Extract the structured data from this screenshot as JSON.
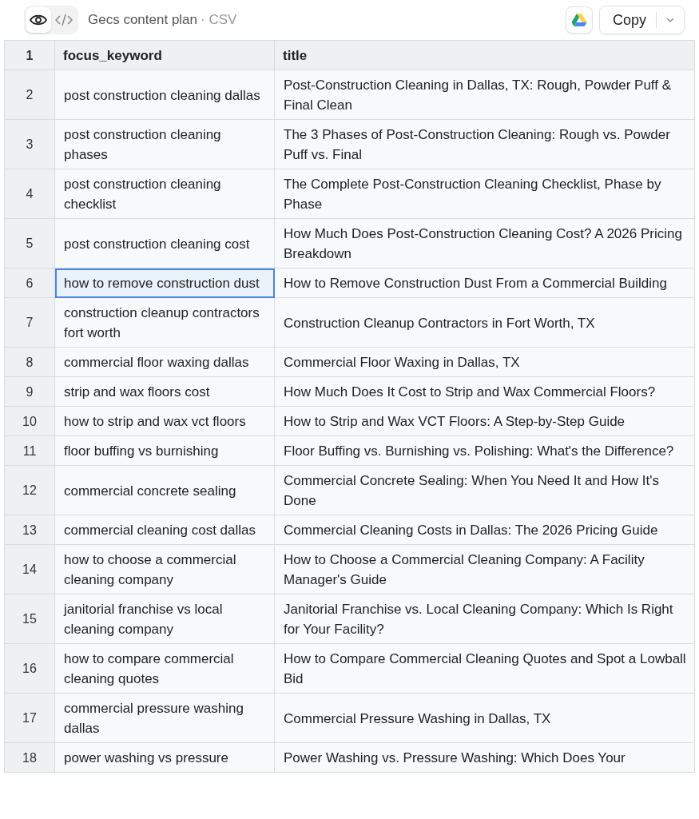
{
  "toolbar": {
    "view_toggle": [
      {
        "kind": "preview",
        "selected": true
      },
      {
        "kind": "code",
        "selected": false
      }
    ],
    "title": "Gecs content plan",
    "file_type": "· CSV",
    "copy_button": "Copy"
  },
  "table": {
    "header_number": "1",
    "columns": [
      "focus_keyword",
      "title"
    ],
    "rows": [
      {
        "number": "2",
        "focus_keyword": "post construction cleaning dallas",
        "title": "Post-Construction Cleaning in Dallas, TX: Rough, Powder Puff & Final Clean",
        "selected": false
      },
      {
        "number": "3",
        "focus_keyword": "post construction cleaning phases",
        "title": "The 3 Phases of Post-Construction Cleaning: Rough vs. Powder Puff vs. Final",
        "selected": false
      },
      {
        "number": "4",
        "focus_keyword": "post construction cleaning checklist",
        "title": "The Complete Post-Construction Cleaning Checklist, Phase by Phase",
        "selected": false
      },
      {
        "number": "5",
        "focus_keyword": "post construction cleaning cost",
        "title": "How Much Does Post-Construction Cleaning Cost? A 2026 Pricing Breakdown",
        "selected": false
      },
      {
        "number": "6",
        "focus_keyword": "how to remove construction dust",
        "title": "How to Remove Construction Dust From a Commercial Building",
        "selected": true
      },
      {
        "number": "7",
        "focus_keyword": "construction cleanup contractors fort worth",
        "title": "Construction Cleanup Contractors in Fort Worth, TX",
        "selected": false
      },
      {
        "number": "8",
        "focus_keyword": "commercial floor waxing dallas",
        "title": "Commercial Floor Waxing in Dallas, TX",
        "selected": false
      },
      {
        "number": "9",
        "focus_keyword": "strip and wax floors cost",
        "title": "How Much Does It Cost to Strip and Wax Commercial Floors?",
        "selected": false
      },
      {
        "number": "10",
        "focus_keyword": "how to strip and wax vct floors",
        "title": "How to Strip and Wax VCT Floors: A Step-by-Step Guide",
        "selected": false
      },
      {
        "number": "11",
        "focus_keyword": "floor buffing vs burnishing",
        "title": "Floor Buffing vs. Burnishing vs. Polishing: What's the Difference?",
        "selected": false
      },
      {
        "number": "12",
        "focus_keyword": "commercial concrete sealing",
        "title": "Commercial Concrete Sealing: When You Need It and How It's Done",
        "selected": false
      },
      {
        "number": "13",
        "focus_keyword": "commercial cleaning cost dallas",
        "title": "Commercial Cleaning Costs in Dallas: The 2026 Pricing Guide",
        "selected": false
      },
      {
        "number": "14",
        "focus_keyword": "how to choose a commercial cleaning company",
        "title": "How to Choose a Commercial Cleaning Company: A Facility Manager's Guide",
        "selected": false
      },
      {
        "number": "15",
        "focus_keyword": "janitorial franchise vs local cleaning company",
        "title": "Janitorial Franchise vs. Local Cleaning Company: Which Is Right for Your Facility?",
        "selected": false
      },
      {
        "number": "16",
        "focus_keyword": "how to compare commercial cleaning quotes",
        "title": "How to Compare Commercial Cleaning Quotes and Spot a Lowball Bid",
        "selected": false
      },
      {
        "number": "17",
        "focus_keyword": "commercial pressure washing dallas",
        "title": "Commercial Pressure Washing in Dallas, TX",
        "selected": false
      },
      {
        "number": "18",
        "focus_keyword": "power washing vs pressure",
        "title": "Power Washing vs. Pressure Washing: Which Does Your",
        "selected": false
      }
    ]
  }
}
